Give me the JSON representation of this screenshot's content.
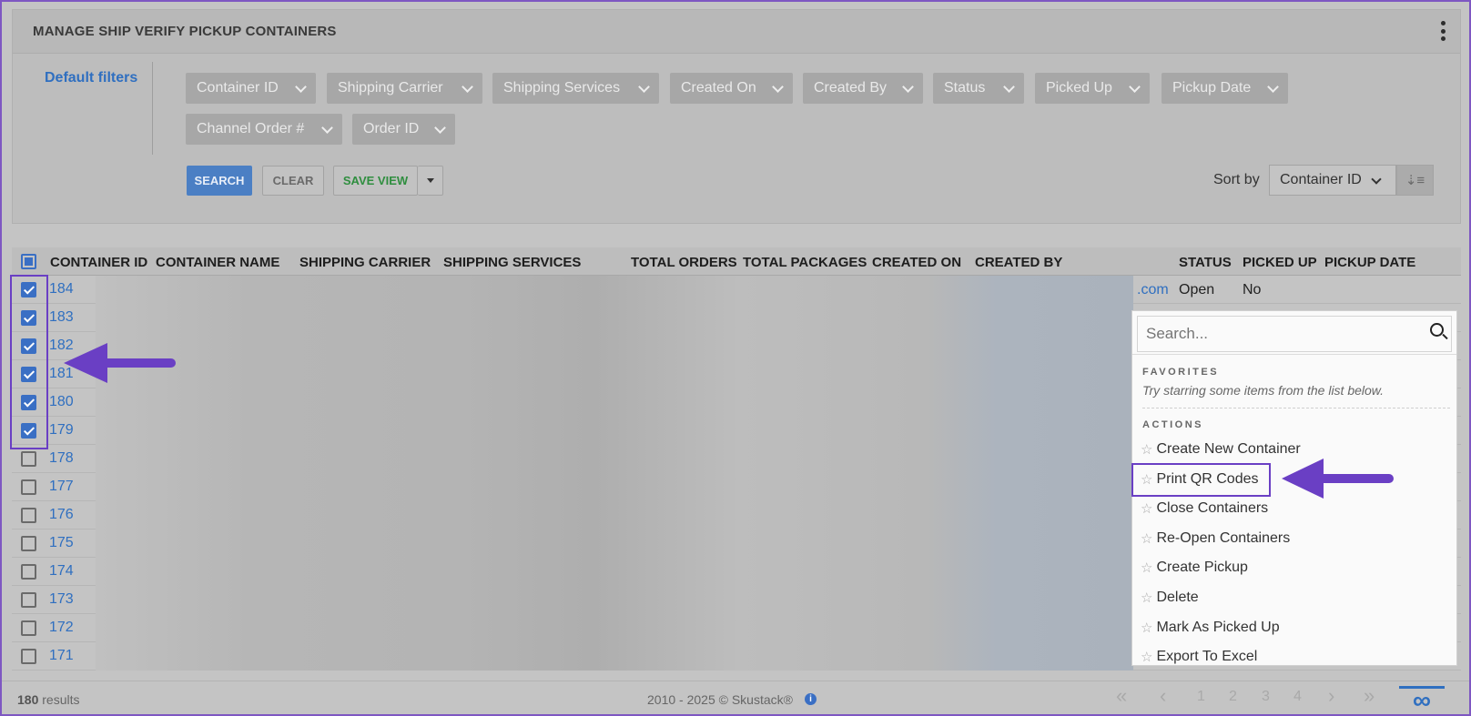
{
  "panel": {
    "title": "MANAGE SHIP VERIFY PICKUP CONTAINERS",
    "default_filters_label": "Default filters",
    "filters": [
      "Container ID",
      "Shipping Carrier",
      "Shipping Services",
      "Created On",
      "Created By",
      "Status",
      "Picked Up",
      "Pickup Date",
      "Channel Order #",
      "Order ID"
    ],
    "buttons": {
      "search": "SEARCH",
      "clear": "CLEAR",
      "save_view": "SAVE VIEW"
    },
    "sort_by_label": "Sort by",
    "sort_by_value": "Container ID"
  },
  "table": {
    "headers": [
      "CONTAINER ID",
      "CONTAINER NAME",
      "SHIPPING CARRIER",
      "SHIPPING SERVICES",
      "TOTAL ORDERS",
      "TOTAL PACKAGES",
      "CREATED ON",
      "CREATED BY",
      "STATUS",
      "PICKED UP",
      "PICKUP DATE"
    ],
    "rows": [
      {
        "id": "184",
        "checked": true
      },
      {
        "id": "183",
        "checked": true
      },
      {
        "id": "182",
        "checked": true
      },
      {
        "id": "181",
        "checked": true
      },
      {
        "id": "180",
        "checked": true
      },
      {
        "id": "179",
        "checked": true
      },
      {
        "id": "178",
        "checked": false
      },
      {
        "id": "177",
        "checked": false
      },
      {
        "id": "176",
        "checked": false
      },
      {
        "id": "175",
        "checked": false
      },
      {
        "id": "174",
        "checked": false
      },
      {
        "id": "173",
        "checked": false
      },
      {
        "id": "172",
        "checked": false
      },
      {
        "id": "171",
        "checked": false
      }
    ],
    "first_row": {
      "created_by_suffix": ".com",
      "status": "Open",
      "picked_up": "No"
    }
  },
  "dropdown": {
    "search_placeholder": "Search...",
    "favorites_label": "FAVORITES",
    "favorites_hint": "Try starring some items from the list below.",
    "actions_label": "ACTIONS",
    "actions": [
      "Create New Container",
      "Print QR Codes",
      "Close Containers",
      "Re-Open Containers",
      "Create Pickup",
      "Delete",
      "Mark As Picked Up",
      "Export To Excel"
    ]
  },
  "footer": {
    "results_count": "180",
    "results_label": "results",
    "copyright": "2010 - 2025 © Skustack®",
    "pages": [
      "1",
      "2",
      "3",
      "4"
    ]
  },
  "colors": {
    "accent": "#2f6fc0",
    "highlight": "#6a3fc4",
    "save_green": "#2f8e3f"
  }
}
